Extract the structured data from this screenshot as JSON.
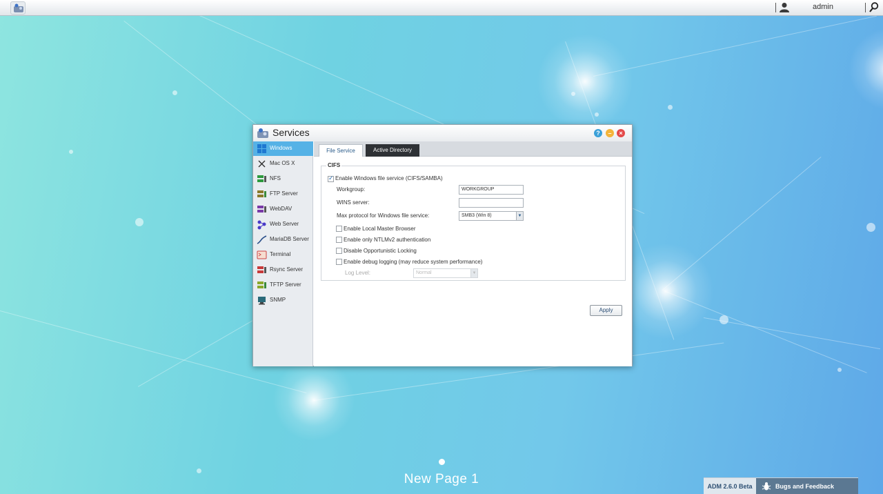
{
  "topbar": {
    "user_name": "admin"
  },
  "window": {
    "title": "Services"
  },
  "sidebar": {
    "items": [
      {
        "label": "Windows",
        "icon": "windows-icon",
        "active": true
      },
      {
        "label": "Mac OS X",
        "icon": "mac-os-x-icon"
      },
      {
        "label": "NFS",
        "icon": "nfs-icon"
      },
      {
        "label": "FTP Server",
        "icon": "ftp-server-icon"
      },
      {
        "label": "WebDAV",
        "icon": "webdav-icon"
      },
      {
        "label": "Web Server",
        "icon": "web-server-icon"
      },
      {
        "label": "MariaDB Server",
        "icon": "mariadb-server-icon"
      },
      {
        "label": "Terminal",
        "icon": "terminal-icon"
      },
      {
        "label": "Rsync Server",
        "icon": "rsync-server-icon"
      },
      {
        "label": "TFTP Server",
        "icon": "tftp-server-icon"
      },
      {
        "label": "SNMP",
        "icon": "snmp-icon"
      }
    ]
  },
  "tabs": {
    "file_service": "File Service",
    "active_directory": "Active Directory"
  },
  "cifs": {
    "legend": "CIFS",
    "enable_label": "Enable Windows file service (CIFS/SAMBA)",
    "enable_checked": true,
    "workgroup_label": "Workgroup:",
    "workgroup_value": "WORKGROUP",
    "wins_label": "WINS server:",
    "wins_value": "",
    "max_protocol_label": "Max protocol for Windows file service:",
    "max_protocol_value": "SMB3 (Win 8)",
    "local_master_label": "Enable Local Master Browser",
    "ntlmv2_label": "Enable only NTLMv2 authentication",
    "oplocks_label": "Disable Opportunistic Locking",
    "debug_label": "Enable debug logging (may reduce system performance)",
    "log_level_label": "Log Level:",
    "log_level_value": "Normal"
  },
  "apply_label": "Apply",
  "desktop": {
    "page_label": "New Page 1"
  },
  "statusbar": {
    "version": "ADM 2.6.0 Beta",
    "bugs_label": "Bugs and Feedback"
  },
  "colors": {
    "accent": "#55b2e6",
    "tab_dark": "#2e3135"
  }
}
